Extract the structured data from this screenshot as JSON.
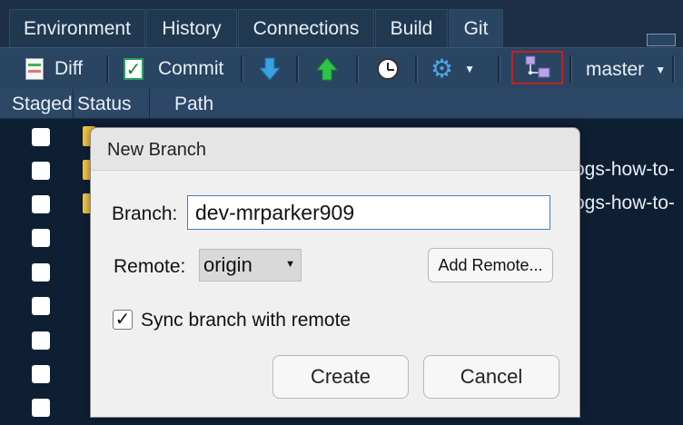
{
  "tabs": [
    {
      "label": "Environment"
    },
    {
      "label": "History"
    },
    {
      "label": "Connections"
    },
    {
      "label": "Build"
    },
    {
      "label": "Git"
    }
  ],
  "toolbar": {
    "diff_label": "Diff",
    "commit_label": "Commit",
    "branch_name": "master"
  },
  "columns": {
    "staged": "Staged",
    "status": "Status",
    "path": "Path"
  },
  "file_rows": [
    {
      "path": ""
    },
    {
      "path": "ogs-how-to-"
    },
    {
      "path": "ogs-how-to-"
    },
    {
      "path": ""
    },
    {
      "path": ""
    },
    {
      "path": ""
    },
    {
      "path": ""
    },
    {
      "path": ""
    },
    {
      "path": ""
    }
  ],
  "dialog": {
    "title": "New Branch",
    "branch_label": "Branch:",
    "branch_value": "dev-mrparker909",
    "remote_label": "Remote:",
    "remote_value": "origin",
    "add_remote_label": "Add Remote...",
    "sync_label": "Sync branch with remote",
    "sync_checked": true,
    "create_label": "Create",
    "cancel_label": "Cancel"
  },
  "colors": {
    "highlight_border": "#c52020",
    "push_arrow": "#2ec44a",
    "pull_arrow": "#3aa0e0",
    "input_focus": "#3a80c8"
  }
}
